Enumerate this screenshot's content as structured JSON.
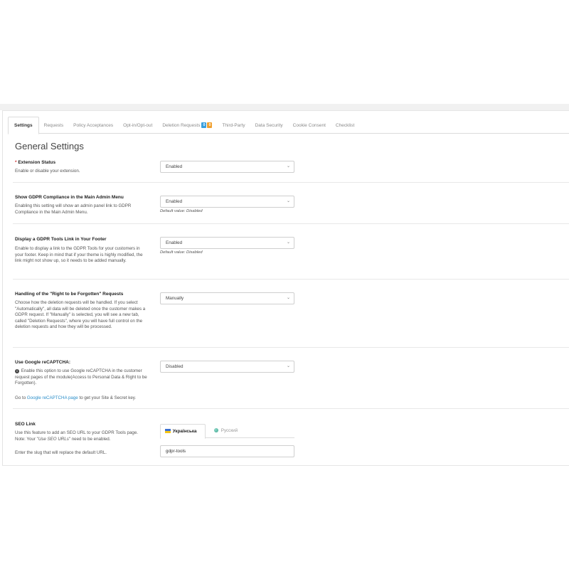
{
  "tabs": [
    {
      "label": "Settings"
    },
    {
      "label": "Requests"
    },
    {
      "label": "Policy Acceptances"
    },
    {
      "label": "Opt-in/Opt-out"
    },
    {
      "label": "Deletion Requests",
      "badges": [
        "0",
        "0"
      ]
    },
    {
      "label": "Third-Party"
    },
    {
      "label": "Data Security"
    },
    {
      "label": "Cookie Consent"
    },
    {
      "label": "Checklist"
    }
  ],
  "page_title": "General Settings",
  "settings": {
    "extension_status": {
      "required_mark": "*",
      "label": "Extension Status",
      "help": "Enable or disable your extension.",
      "value": "Enabled"
    },
    "admin_menu": {
      "label": "Show GDPR Compliance in the Main Admin Menu",
      "help": "Enabling this setting will show an admin panel link to GDPR Compliance in the Main Admin Menu.",
      "value": "Enabled",
      "default": "Default value: Disabled"
    },
    "footer_link": {
      "label": "Display a GDPR Tools Link in Your Footer",
      "help": "Enable to display a link to the GDPR Tools for your customers in your footer. Keep in mind that if your theme is highly modified, the link might not show up, so it needs to be added manually.",
      "value": "Enabled",
      "default": "Default value: Disabled"
    },
    "right_forgotten": {
      "label": "Handling of the \"Right to be Forgotten\" Requests",
      "help": "Choose how the deletion requests will be handled. If you select \"Automatically\", all data will be deleted once the customer makes a GDPR request. If \"Manually\" is selected, you will see a new tab, called \"Deletion Requests\", where you will have full control on the deletion requests and how they will be processed.",
      "value": "Manually"
    },
    "recaptcha": {
      "label": "Use Google reCAPTCHA:",
      "help": "Enable this option to use Google reCAPTCHA in the customer request pages of the module(Access to Personal Data & Right to be Forgotten).",
      "goto_prefix": "Go to ",
      "goto_link": "Google reCAPTCHA page",
      "goto_suffix": " to get your Site & Secret key.",
      "value": "Disabled"
    },
    "seo_link": {
      "label": "SEO Link",
      "help_prefix": "Use this feature to add an SEO URL to your GDPR Tools page. Note: Your \"",
      "help_em": "Use SEO URLs",
      "help_suffix": "\" need to be enabled.",
      "help2": "Enter the slug that will replace the default URL.",
      "lang_active": "Українська",
      "lang_inactive": "Русский",
      "value": "gdpr-tools"
    }
  },
  "icons": {
    "chevron": "chevron-down-icon",
    "info": "info-icon",
    "flag_ua": "flag-ukraine-icon",
    "flag_ru": "flag-russia-icon"
  }
}
